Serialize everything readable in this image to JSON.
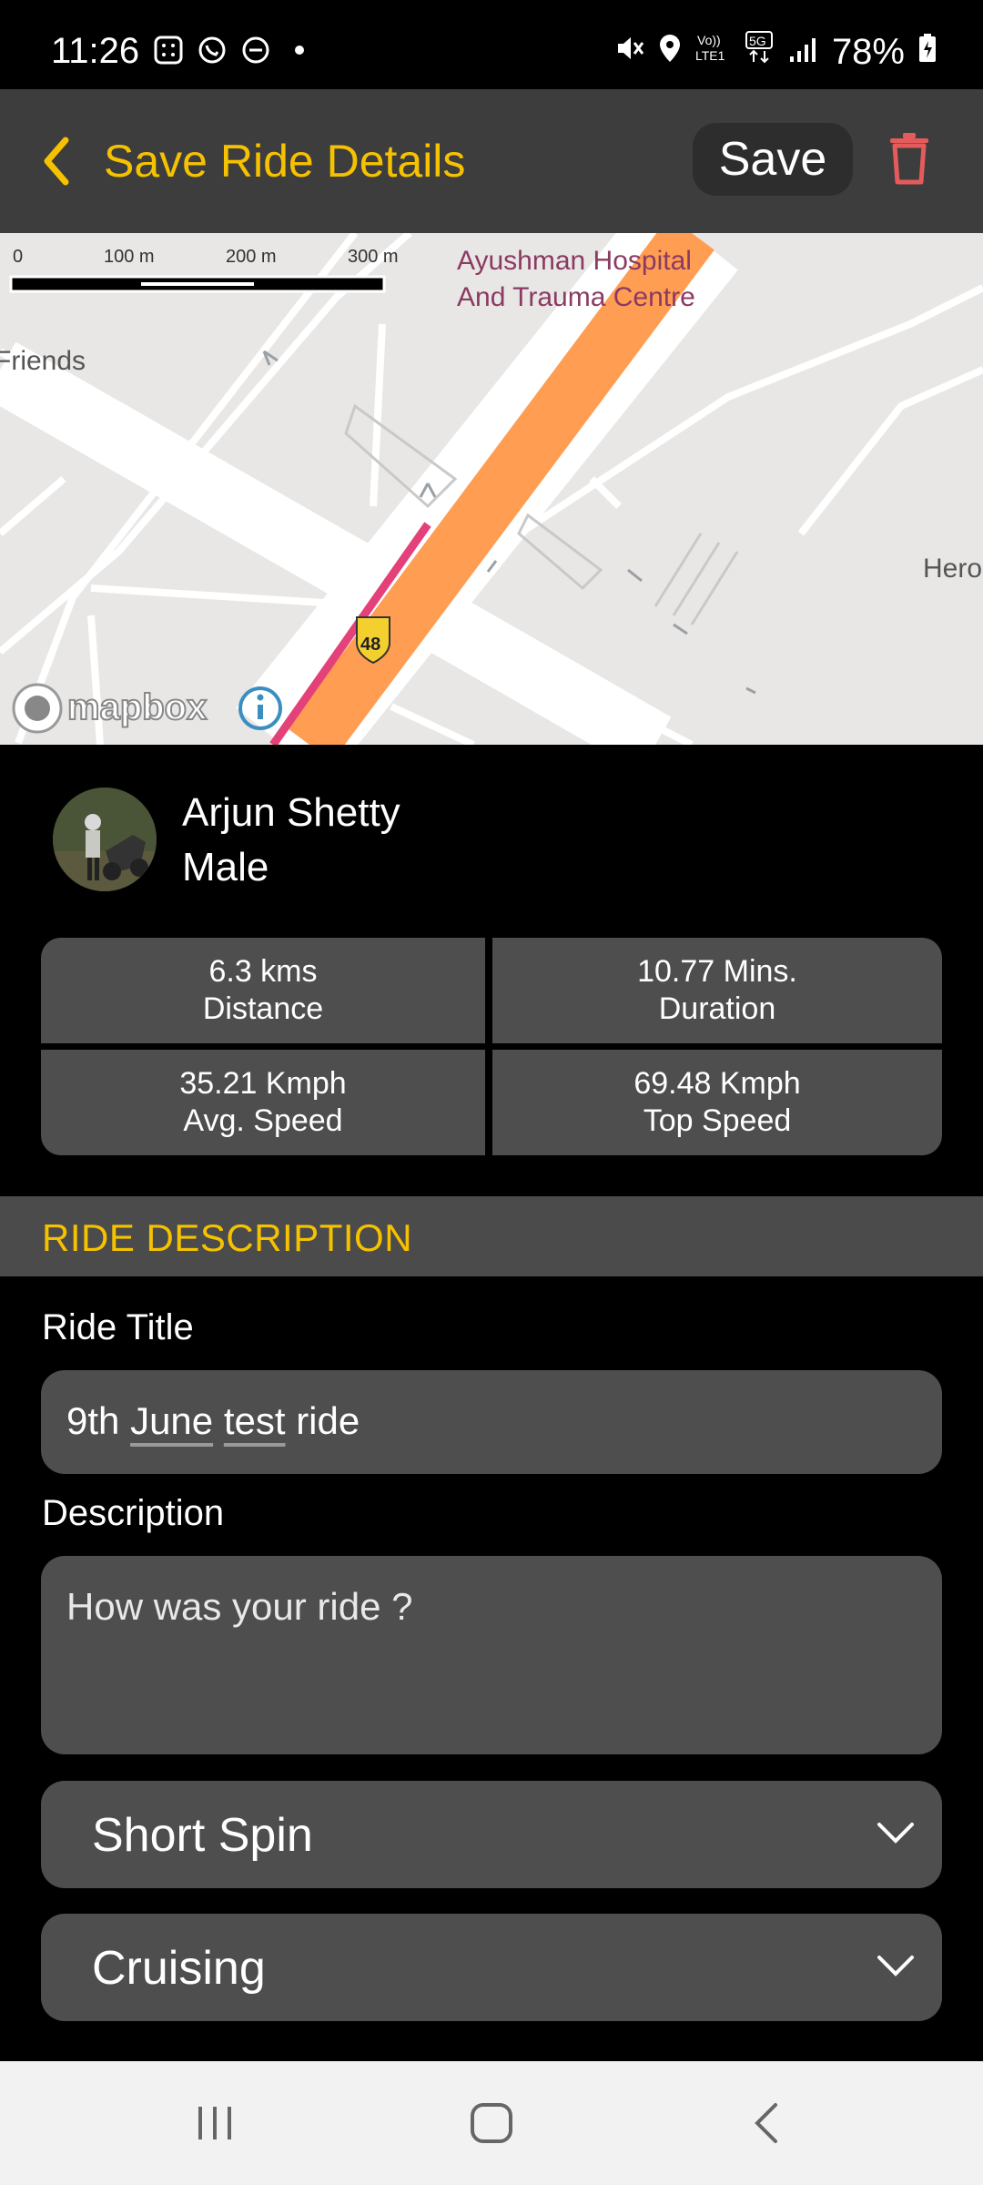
{
  "status": {
    "time": "11:26",
    "battery": "78%"
  },
  "appbar": {
    "title": "Save Ride Details",
    "save_label": "Save"
  },
  "map": {
    "scale": [
      "0",
      "100 m",
      "200 m",
      "300 m"
    ],
    "hospital_line1": "Ayushman Hospital",
    "hospital_line2": "And Trauma Centre",
    "friends": "Friends",
    "hero": "Hero",
    "road_shield": "48",
    "attribution": "mapbox"
  },
  "profile": {
    "name": "Arjun Shetty",
    "gender": "Male"
  },
  "stats": [
    {
      "value": "6.3 kms",
      "label": "Distance"
    },
    {
      "value": "10.77 Mins.",
      "label": "Duration"
    },
    {
      "value": "35.21 Kmph",
      "label": "Avg. Speed"
    },
    {
      "value": "69.48 Kmph",
      "label": "Top Speed"
    }
  ],
  "section_title": "RIDE DESCRIPTION",
  "form": {
    "title_label": "Ride Title",
    "title_word1": "9th",
    "title_word2": "June",
    "title_word3": "test",
    "title_word4": "ride",
    "description_label": "Description",
    "description_placeholder": "How was your ride ?",
    "ride_type": "Short Spin",
    "ride_style": "Cruising"
  },
  "colors": {
    "accent": "#f6c200",
    "danger": "#e55b5b",
    "field_bg": "#4e4e4e",
    "appbar_bg": "#3d3d3d"
  }
}
